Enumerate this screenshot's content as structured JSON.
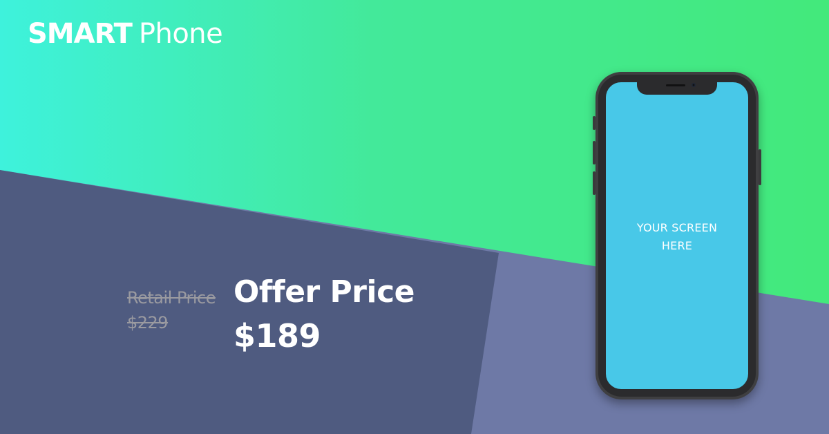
{
  "brand": {
    "name_bold": "SMART",
    "name_light": "Phone"
  },
  "pricing": {
    "retail_label": "Retail Price",
    "retail_value": "$229",
    "offer_label": "Offer Price",
    "offer_value": "$189"
  },
  "phone": {
    "screen_line1": "YOUR SCREEN",
    "screen_line2": "HERE"
  },
  "colors": {
    "gradient_start": "#3ef2dc",
    "gradient_end": "#43e97b",
    "navy_panel": "#4f5b80",
    "slate_panel": "#6e79a6",
    "screen": "#48c8e8",
    "phone_body": "#3f3f41",
    "retail_text": "#9a9aa0"
  }
}
